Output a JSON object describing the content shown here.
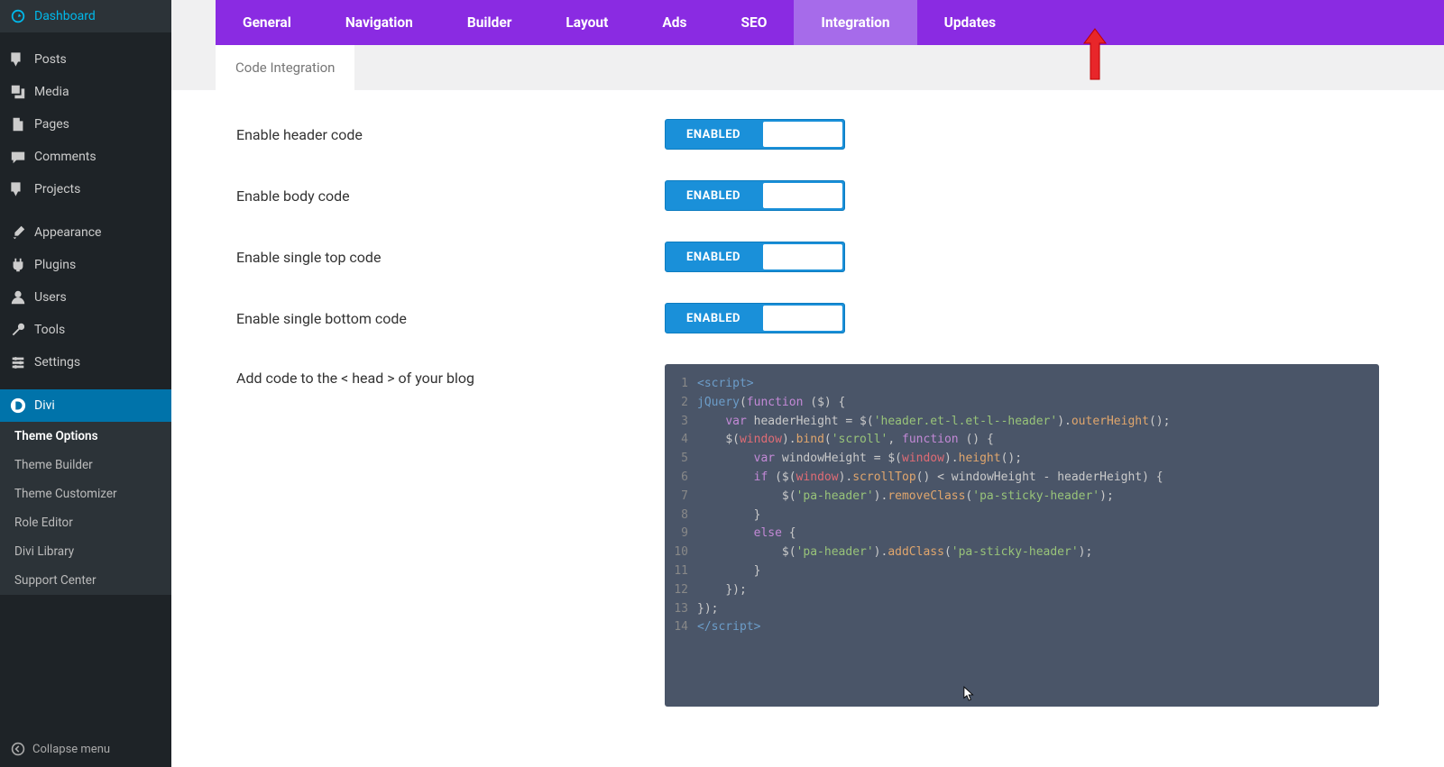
{
  "sidebar": {
    "items": [
      {
        "icon": "dashboard",
        "label": "Dashboard"
      },
      {
        "icon": "pin",
        "label": "Posts"
      },
      {
        "icon": "media",
        "label": "Media"
      },
      {
        "icon": "page",
        "label": "Pages"
      },
      {
        "icon": "comment",
        "label": "Comments"
      },
      {
        "icon": "pin",
        "label": "Projects"
      },
      {
        "icon": "brush",
        "label": "Appearance"
      },
      {
        "icon": "plug",
        "label": "Plugins"
      },
      {
        "icon": "user",
        "label": "Users"
      },
      {
        "icon": "wrench",
        "label": "Tools"
      },
      {
        "icon": "gear",
        "label": "Settings"
      },
      {
        "icon": "divi",
        "label": "Divi"
      }
    ],
    "submenu": [
      "Theme Options",
      "Theme Builder",
      "Theme Customizer",
      "Role Editor",
      "Divi Library",
      "Support Center"
    ],
    "collapse": "Collapse menu"
  },
  "tabs": [
    "General",
    "Navigation",
    "Builder",
    "Layout",
    "Ads",
    "SEO",
    "Integration",
    "Updates"
  ],
  "activeTab": "Integration",
  "subtab": "Code Integration",
  "settings": [
    {
      "label": "Enable header code",
      "state": "ENABLED"
    },
    {
      "label": "Enable body code",
      "state": "ENABLED"
    },
    {
      "label": "Enable single top code",
      "state": "ENABLED"
    },
    {
      "label": "Enable single bottom code",
      "state": "ENABLED"
    }
  ],
  "codeLabel": "Add code to the < head > of your blog",
  "code": {
    "l1": "script",
    "l2_a": "jQuery",
    "l2_b": "function",
    "l2_c": " ($) {",
    "l3_a": "var",
    "l3_b": " headerHeight ",
    "l3_c": "= $(",
    "l3_d": "'header.et-l.et-l--header'",
    "l3_e": ").",
    "l3_f": "outerHeight",
    "l3_g": "();",
    "l4_a": "$(",
    "l4_b": "window",
    "l4_c": ").",
    "l4_d": "bind",
    "l4_e": "(",
    "l4_f": "'scroll'",
    "l4_g": ", ",
    "l4_h": "function",
    "l4_i": " () {",
    "l5_a": "var",
    "l5_b": " windowHeight ",
    "l5_c": "= $(",
    "l5_d": "window",
    "l5_e": ").",
    "l5_f": "height",
    "l5_g": "();",
    "l6_a": "if",
    "l6_b": " ($(",
    "l6_c": "window",
    "l6_d": ").",
    "l6_e": "scrollTop",
    "l6_f": "() < windowHeight - headerHeight) {",
    "l7_a": "$(",
    "l7_b": "'pa-header'",
    "l7_c": ").",
    "l7_d": "removeClass",
    "l7_e": "(",
    "l7_f": "'pa-sticky-header'",
    "l7_g": ");",
    "l8": "}",
    "l9_a": "else",
    "l9_b": " {",
    "l10_a": "$(",
    "l10_b": "'pa-header'",
    "l10_c": ").",
    "l10_d": "addClass",
    "l10_e": "(",
    "l10_f": "'pa-sticky-header'",
    "l10_g": ");",
    "l11": "}",
    "l12": "});",
    "l13": "});",
    "l14": "/script"
  }
}
